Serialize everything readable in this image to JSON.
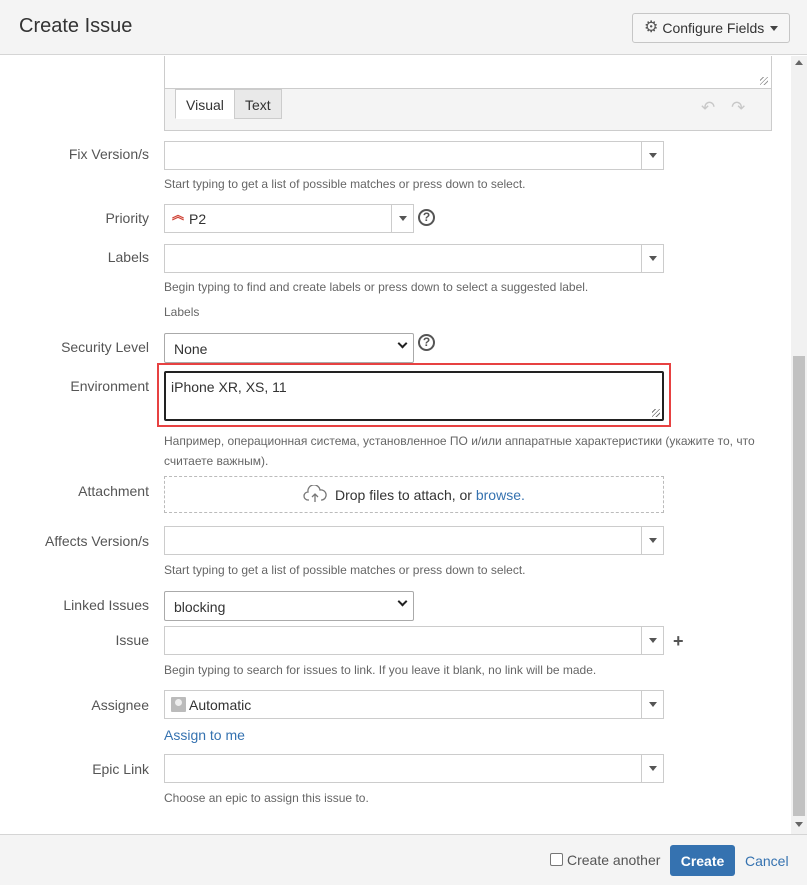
{
  "dialog": {
    "title": "Create Issue",
    "configure_fields": "Configure Fields"
  },
  "editor": {
    "tab_visual": "Visual",
    "tab_text": "Text"
  },
  "fix_version": {
    "label": "Fix Version/s",
    "hint": "Start typing to get a list of possible matches or press down to select."
  },
  "priority": {
    "label": "Priority",
    "value": "P2"
  },
  "labels": {
    "label": "Labels",
    "hint": "Begin typing to find and create labels or press down to select a suggested label.",
    "subhint": "Labels"
  },
  "security": {
    "label": "Security Level",
    "value": "None"
  },
  "environment": {
    "label": "Environment",
    "value": "iPhone XR, XS, 11",
    "hint_line1": "Например, операционная система, установленное ПО и/или аппаратные характеристики (укажите то, что",
    "hint_line2": "считаете важным)."
  },
  "attachment": {
    "label": "Attachment",
    "drop_text": "Drop files to attach, or ",
    "browse": "browse."
  },
  "affects_version": {
    "label": "Affects Version/s",
    "hint": "Start typing to get a list of possible matches or press down to select."
  },
  "linked_issues": {
    "label": "Linked Issues",
    "value": "blocking"
  },
  "issue": {
    "label": "Issue",
    "hint": "Begin typing to search for issues to link. If you leave it blank, no link will be made."
  },
  "assignee": {
    "label": "Assignee",
    "value": "Automatic",
    "assign_to_me": "Assign to me"
  },
  "epic_link": {
    "label": "Epic Link",
    "hint": "Choose an epic to assign this issue to."
  },
  "footer": {
    "create_another": "Create another",
    "create": "Create",
    "cancel": "Cancel"
  },
  "colors": {
    "accent": "#3572b0",
    "highlight": "#e74141",
    "priority": "#d04437"
  }
}
